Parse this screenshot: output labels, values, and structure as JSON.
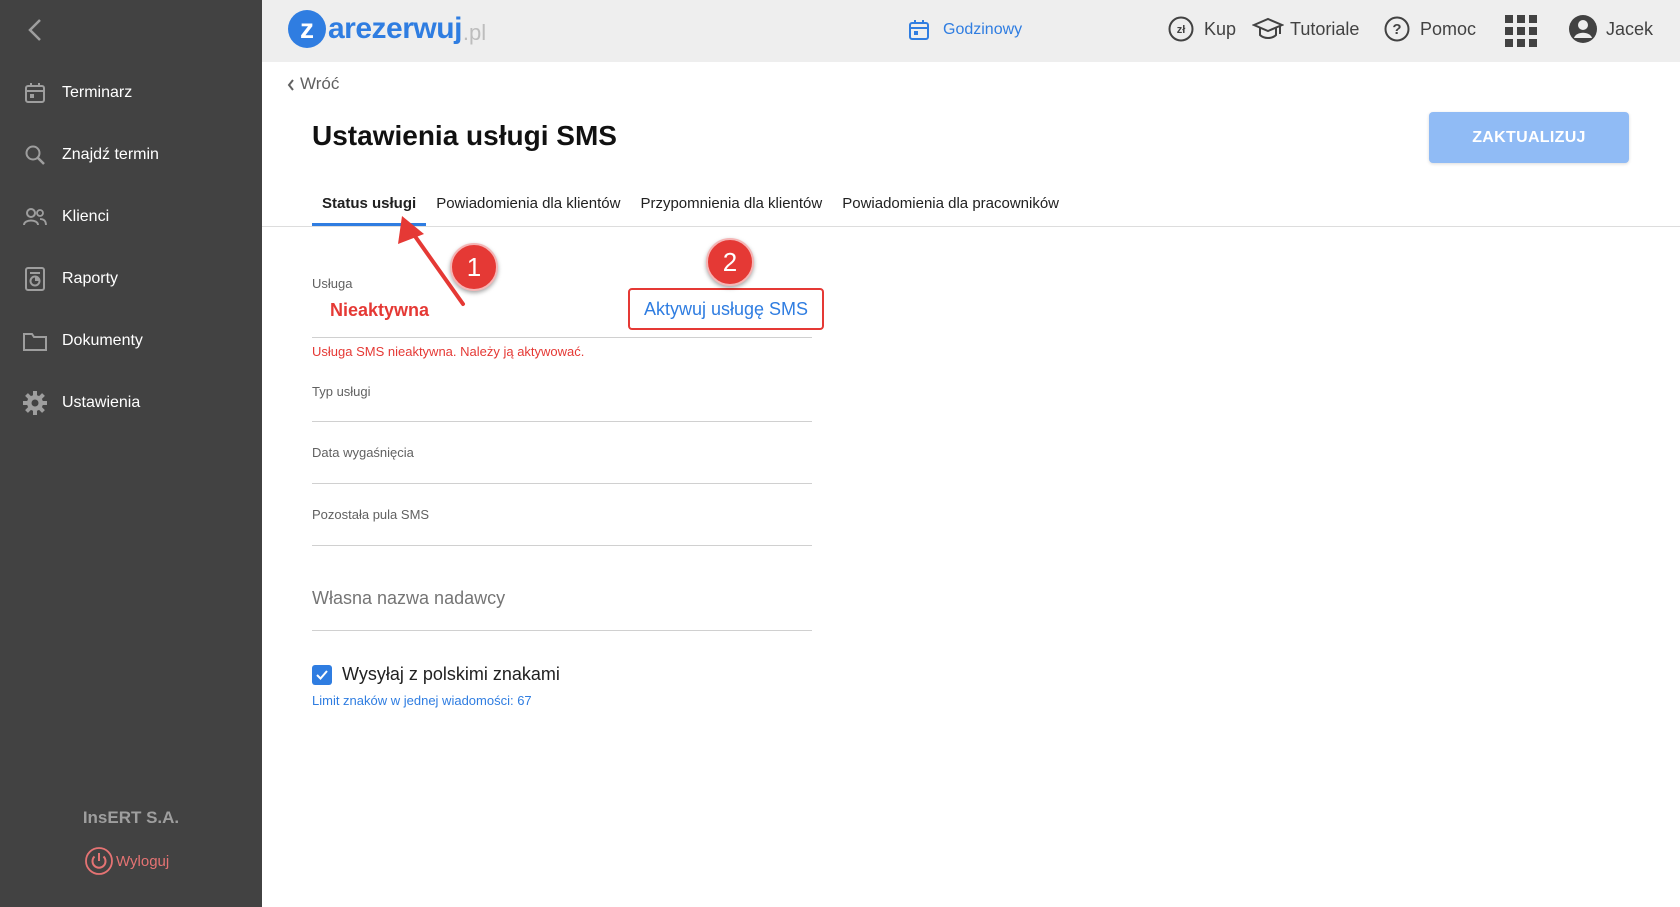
{
  "sidebar": {
    "items": [
      {
        "label": "Terminarz",
        "icon": "calendar-icon"
      },
      {
        "label": "Znajdź termin",
        "icon": "search-icon"
      },
      {
        "label": "Klienci",
        "icon": "people-icon"
      },
      {
        "label": "Raporty",
        "icon": "report-icon"
      },
      {
        "label": "Dokumenty",
        "icon": "folder-icon"
      },
      {
        "label": "Ustawienia",
        "icon": "gear-icon"
      }
    ],
    "company": "InsERT S.A.",
    "logout_label": "Wyloguj"
  },
  "topbar": {
    "logo_letter": "z",
    "logo_word": "arezerwuj",
    "logo_tld": ".pl",
    "mode_label": "Godzinowy",
    "buy_label": "Kup",
    "tutorials_label": "Tutoriale",
    "help_label": "Pomoc",
    "user_name": "Jacek"
  },
  "page": {
    "back_label": "Wróć",
    "title": "Ustawienia usługi SMS",
    "update_label": "ZAKTUALIZUJ",
    "tabs": [
      {
        "label": "Status usługi",
        "active": true
      },
      {
        "label": "Powiadomienia dla klientów",
        "active": false
      },
      {
        "label": "Przypomnienia dla klientów",
        "active": false
      },
      {
        "label": "Powiadomienia dla pracowników",
        "active": false
      }
    ]
  },
  "form": {
    "service_label": "Usługa",
    "service_value": "Nieaktywna",
    "activate_label": "Aktywuj usługę SMS",
    "error_text": "Usługa SMS nieaktywna. Należy ją aktywować.",
    "type_label": "Typ usługi",
    "expiry_label": "Data wygaśnięcia",
    "pool_label": "Pozostała pula SMS",
    "sender_placeholder": "Własna nazwa nadawcy",
    "polish_chars_label": "Wysyłaj z polskimi znakami",
    "polish_chars_checked": true,
    "limit_text": "Limit znaków w jednej wiadomości: 67"
  },
  "annotations": {
    "badge1": "1",
    "badge2": "2"
  },
  "colors": {
    "sidebar_bg": "#424242",
    "accent": "#2f7de1",
    "error": "#e53935",
    "update_button": "#90bbf5"
  }
}
